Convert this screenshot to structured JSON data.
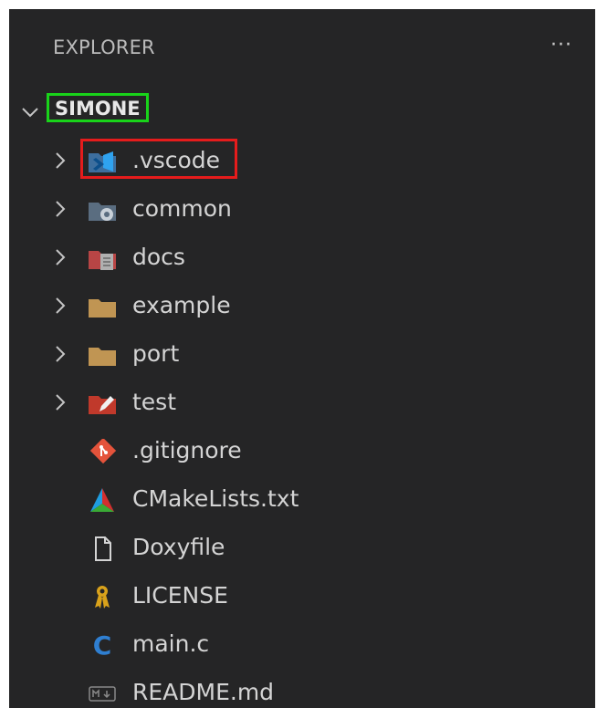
{
  "explorer": {
    "title": "EXPLORER",
    "more_actions": "···"
  },
  "root": {
    "name": "SIMONE",
    "expanded": true
  },
  "items": [
    {
      "label": ".vscode",
      "type": "folder",
      "icon": "vscode-folder-icon"
    },
    {
      "label": "common",
      "type": "folder",
      "icon": "common-folder-icon"
    },
    {
      "label": "docs",
      "type": "folder",
      "icon": "docs-folder-icon"
    },
    {
      "label": "example",
      "type": "folder",
      "icon": "folder-icon"
    },
    {
      "label": "port",
      "type": "folder",
      "icon": "folder-icon"
    },
    {
      "label": "test",
      "type": "folder",
      "icon": "test-folder-icon"
    },
    {
      "label": ".gitignore",
      "type": "file",
      "icon": "git-icon"
    },
    {
      "label": "CMakeLists.txt",
      "type": "file",
      "icon": "cmake-icon"
    },
    {
      "label": "Doxyfile",
      "type": "file",
      "icon": "file-icon"
    },
    {
      "label": "LICENSE",
      "type": "file",
      "icon": "license-icon"
    },
    {
      "label": "main.c",
      "type": "file",
      "icon": "c-file-icon"
    },
    {
      "label": "README.md",
      "type": "file",
      "icon": "markdown-icon"
    }
  ],
  "colors": {
    "background": "#252526",
    "root_highlight": "#19d31a",
    "selection_highlight": "#e51c1c"
  }
}
